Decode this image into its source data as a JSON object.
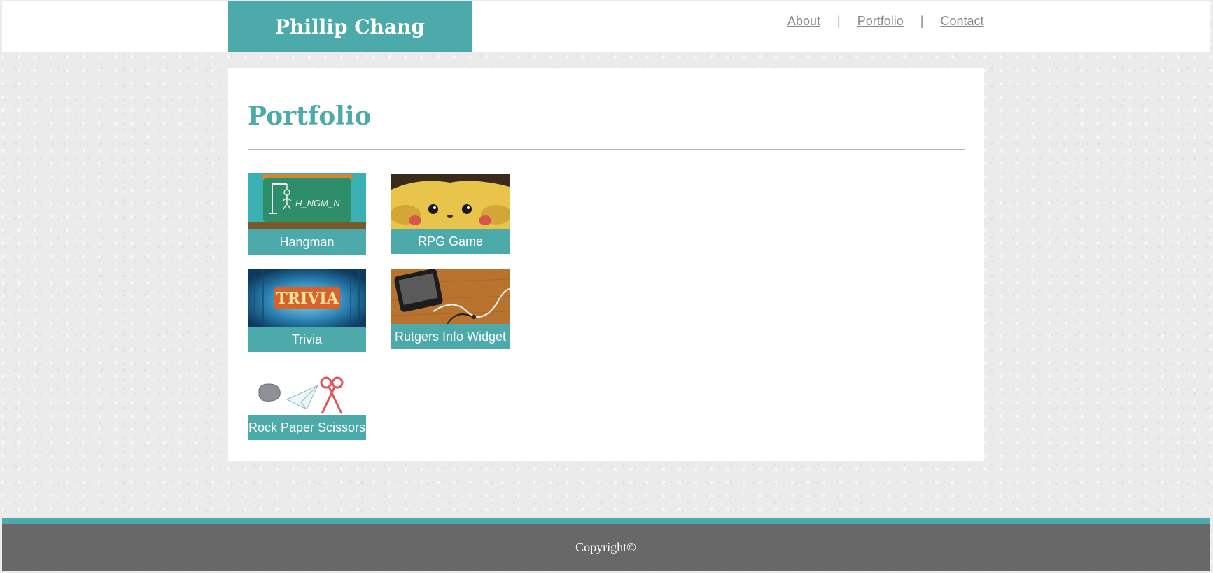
{
  "header": {
    "brand": "Phillip Chang"
  },
  "nav": {
    "about": "About",
    "portfolio": "Portfolio",
    "contact": "Contact",
    "separator": "|"
  },
  "main": {
    "title": "Portfolio"
  },
  "projects": [
    {
      "label": "Hangman",
      "thumb_text": "H_NGM_N"
    },
    {
      "label": "RPG Game"
    },
    {
      "label": "Trivia",
      "thumb_text": "TRIVIA"
    },
    {
      "label": "Rutgers Info Widget"
    },
    {
      "label": "Rock Paper Scissors"
    }
  ],
  "footer": {
    "copyright": "Copyright©"
  },
  "colors": {
    "accent": "#4cabaa",
    "footer": "#686868"
  }
}
